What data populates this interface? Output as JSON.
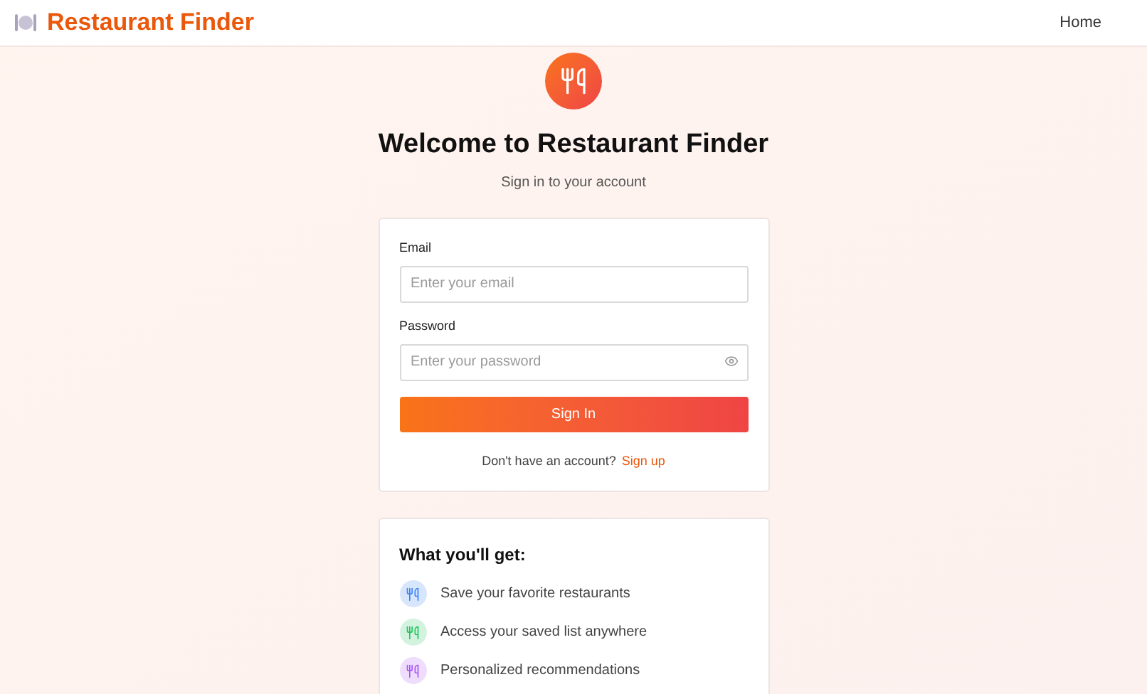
{
  "header": {
    "brand": "Restaurant Finder",
    "nav": [
      "Home"
    ]
  },
  "hero": {
    "title": "Welcome to Restaurant Finder",
    "subtitle": "Sign in to your account"
  },
  "form": {
    "fields": [
      {
        "label": "Email",
        "placeholder": "Enter your email",
        "kind": "text"
      },
      {
        "label": "Password",
        "placeholder": "Enter your password",
        "kind": "password"
      }
    ],
    "submit": "Sign In",
    "footer_text": "Don't have an account?",
    "footer_link": "Sign up"
  },
  "benefits": {
    "title": "What you'll get:",
    "items": [
      {
        "text": "Save your favorite restaurants",
        "color": "#3b82f6"
      },
      {
        "text": "Access your saved list anywhere",
        "color": "#22c55e"
      },
      {
        "text": "Personalized recommendations",
        "color": "#a855f7"
      }
    ]
  }
}
